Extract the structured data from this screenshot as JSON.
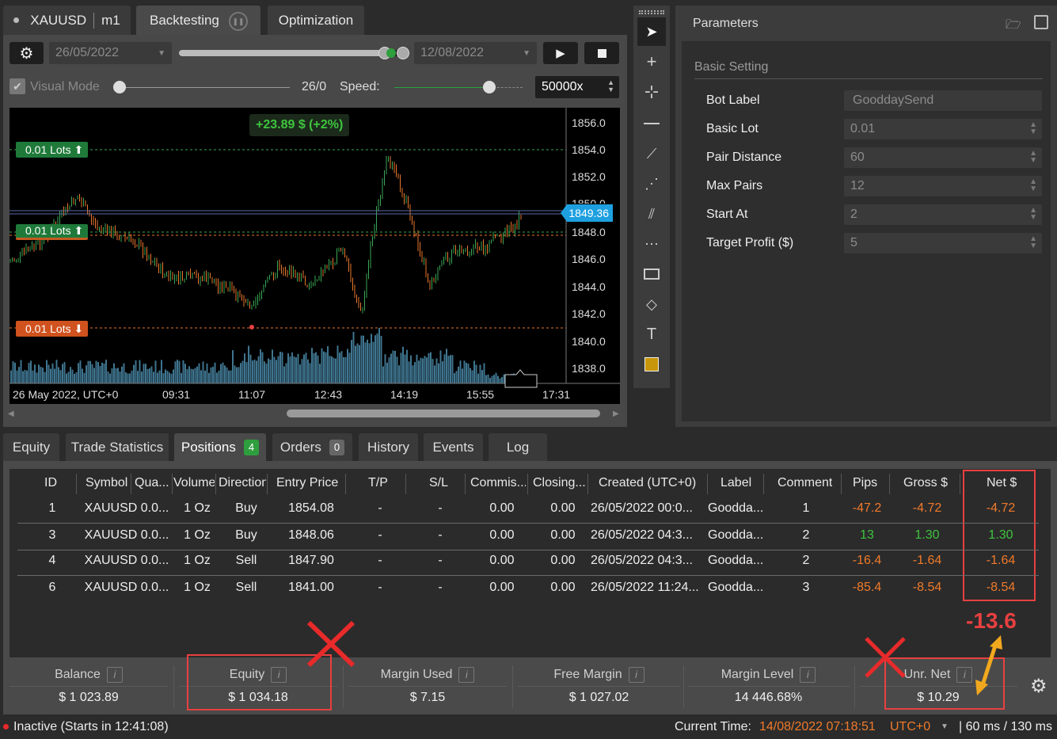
{
  "header": {
    "symbol": "XAUUSD",
    "timeframe": "m1",
    "tabs": [
      "Backtesting",
      "Optimization"
    ],
    "start_date": "26/05/2022",
    "end_date": "12/08/2022",
    "visual_mode_label": "Visual Mode",
    "progress_text": "26/0",
    "speed_label": "Speed:",
    "speed_value": "50000x"
  },
  "chart": {
    "profit_label": "+23.89 $ (+2%)",
    "lot_labels": [
      "0.01 Lots ⬆",
      "0.01 Lots ⬆",
      "0.01 Lots ⬇"
    ],
    "price_tag": "1849.36",
    "y_ticks": [
      "1856.0",
      "1854.0",
      "1852.0",
      "1850.0",
      "1848.0",
      "1846.0",
      "1844.0",
      "1842.0",
      "1840.0",
      "1838.0"
    ],
    "x_ticks": [
      "26 May 2022, UTC+0",
      "09:31",
      "11:07",
      "12:43",
      "14:19",
      "15:55",
      "17:31"
    ],
    "colors": {
      "bull": "#3aa655",
      "bear": "#e8762c",
      "volume": "#4a8aa8",
      "tag": "#1ea0e0"
    }
  },
  "parameters": {
    "title": "Parameters",
    "section": "Basic Setting",
    "rows": [
      {
        "label": "Bot Label",
        "value": "GooddaySend",
        "spinner": false
      },
      {
        "label": "Basic Lot",
        "value": "0.01",
        "spinner": true
      },
      {
        "label": "Pair Distance",
        "value": "60",
        "spinner": true
      },
      {
        "label": "Max Pairs",
        "value": "12",
        "spinner": true
      },
      {
        "label": "Start At",
        "value": "2",
        "spinner": true
      },
      {
        "label": "Target Profit ($)",
        "value": "5",
        "spinner": true
      }
    ]
  },
  "bottom_tabs": [
    {
      "label": "Equity",
      "badge": ""
    },
    {
      "label": "Trade Statistics",
      "badge": ""
    },
    {
      "label": "Positions",
      "badge": "4"
    },
    {
      "label": "Orders",
      "badge": "0"
    },
    {
      "label": "History",
      "badge": ""
    },
    {
      "label": "Events",
      "badge": ""
    },
    {
      "label": "Log",
      "badge": ""
    }
  ],
  "positions": {
    "columns": [
      "ID",
      "Symbol",
      "Qua...",
      "Volume",
      "Direction",
      "Entry Price",
      "T/P",
      "S/L",
      "Commis...",
      "Closing...",
      "Created (UTC+0)",
      "Label",
      "Comment",
      "Pips",
      "Gross $",
      "Net $"
    ],
    "rows": [
      [
        "1",
        "XAUUSD 0.0...",
        "1 Oz",
        "Buy",
        "1854.08",
        "-",
        "-",
        "0.00",
        "0.00",
        "26/05/2022 00:0...",
        "Goodda...",
        "1",
        "-47.2",
        "-4.72",
        "-4.72"
      ],
      [
        "3",
        "XAUUSD 0.0...",
        "1 Oz",
        "Buy",
        "1848.06",
        "-",
        "-",
        "0.00",
        "0.00",
        "26/05/2022 04:3...",
        "Goodda...",
        "2",
        "13",
        "1.30",
        "1.30"
      ],
      [
        "4",
        "XAUUSD 0.0...",
        "1 Oz",
        "Sell",
        "1847.90",
        "-",
        "-",
        "0.00",
        "0.00",
        "26/05/2022 04:3...",
        "Goodda...",
        "2",
        "-16.4",
        "-1.64",
        "-1.64"
      ],
      [
        "6",
        "XAUUSD 0.0...",
        "1 Oz",
        "Sell",
        "1841.00",
        "-",
        "-",
        "0.00",
        "0.00",
        "26/05/2022 11:24...",
        "Goodda...",
        "3",
        "-85.4",
        "-8.54",
        "-8.54"
      ]
    ]
  },
  "summary": [
    {
      "label": "Balance",
      "value": "$ 1 023.89"
    },
    {
      "label": "Equity",
      "value": "$ 1 034.18"
    },
    {
      "label": "Margin Used",
      "value": "$ 7.15"
    },
    {
      "label": "Free Margin",
      "value": "$ 1 027.02"
    },
    {
      "label": "Margin Level",
      "value": "14 446.68%"
    },
    {
      "label": "Unr. Net",
      "value": "$ 10.29"
    }
  ],
  "annotation": {
    "net_sum": "-13.6"
  },
  "status": {
    "state": "Inactive (Starts in 12:41:08)",
    "current_time_label": "Current Time:",
    "current_time": "14/08/2022 07:18:51",
    "timezone": "UTC+0",
    "latency": "| 60 ms / 130 ms"
  }
}
